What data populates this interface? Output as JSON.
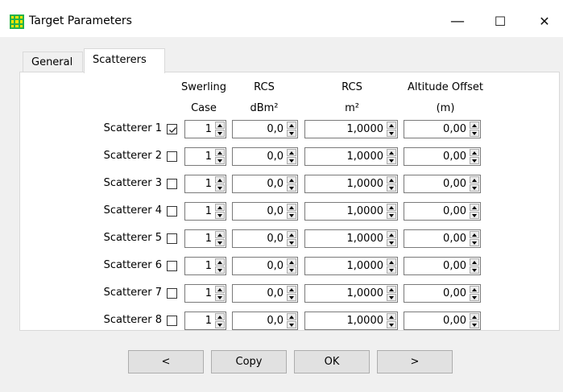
{
  "window": {
    "title": "Target Parameters",
    "minimize_glyph": "—",
    "maximize_glyph": "☐",
    "close_glyph": "✕"
  },
  "tabs": [
    {
      "label": "General",
      "active": false
    },
    {
      "label": "Scatterers",
      "active": true
    }
  ],
  "headers": {
    "swerling_line1": "Swerling",
    "swerling_line2": "Case",
    "rcs_db_line1": "RCS",
    "rcs_db_line2": "dBm²",
    "rcs_m_line1": "RCS",
    "rcs_m_line2": "m²",
    "altitude_line1": "Altitude Offset",
    "altitude_line2": "(m)"
  },
  "scatterers": [
    {
      "label": "Scatterer 1",
      "checked": true,
      "swerling": "1",
      "rcs_db": "0,0",
      "rcs_m2": "1,0000",
      "altitude": "0,00"
    },
    {
      "label": "Scatterer 2",
      "checked": false,
      "swerling": "1",
      "rcs_db": "0,0",
      "rcs_m2": "1,0000",
      "altitude": "0,00"
    },
    {
      "label": "Scatterer 3",
      "checked": false,
      "swerling": "1",
      "rcs_db": "0,0",
      "rcs_m2": "1,0000",
      "altitude": "0,00"
    },
    {
      "label": "Scatterer 4",
      "checked": false,
      "swerling": "1",
      "rcs_db": "0,0",
      "rcs_m2": "1,0000",
      "altitude": "0,00"
    },
    {
      "label": "Scatterer 5",
      "checked": false,
      "swerling": "1",
      "rcs_db": "0,0",
      "rcs_m2": "1,0000",
      "altitude": "0,00"
    },
    {
      "label": "Scatterer 6",
      "checked": false,
      "swerling": "1",
      "rcs_db": "0,0",
      "rcs_m2": "1,0000",
      "altitude": "0,00"
    },
    {
      "label": "Scatterer 7",
      "checked": false,
      "swerling": "1",
      "rcs_db": "0,0",
      "rcs_m2": "1,0000",
      "altitude": "0,00"
    },
    {
      "label": "Scatterer 8",
      "checked": false,
      "swerling": "1",
      "rcs_db": "0,0",
      "rcs_m2": "1,0000",
      "altitude": "0,00"
    }
  ],
  "buttons": {
    "prev": "<",
    "copy": "Copy",
    "ok": "OK",
    "next": ">"
  }
}
